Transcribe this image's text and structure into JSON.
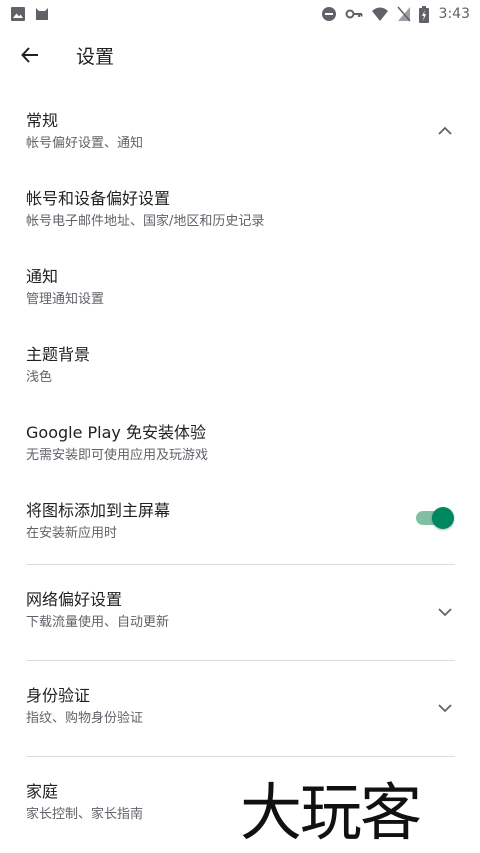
{
  "status_bar": {
    "time": "3:43",
    "icons": [
      "image-icon",
      "cat-icon",
      "do-not-disturb-icon",
      "key-icon",
      "wifi-icon",
      "no-sim-icon",
      "battery-charging-icon"
    ]
  },
  "app_bar": {
    "title": "设置",
    "back_icon": "arrow-back-icon"
  },
  "settings": [
    {
      "title": "常规",
      "subtitle": "帐号偏好设置、通知",
      "icon": "chevron-up-icon"
    },
    {
      "title": "帐号和设备偏好设置",
      "subtitle": "帐号电子邮件地址、国家/地区和历史记录"
    },
    {
      "title": "通知",
      "subtitle": "管理通知设置"
    },
    {
      "title": "主题背景",
      "subtitle": "浅色"
    },
    {
      "title": "Google Play 免安装体验",
      "subtitle": "无需安装即可使用应用及玩游戏"
    },
    {
      "title": "将图标添加到主屏幕",
      "subtitle": "在安装新应用时",
      "toggle": true
    }
  ],
  "sections": [
    {
      "title": "网络偏好设置",
      "subtitle": "下载流量使用、自动更新",
      "icon": "chevron-down-icon"
    },
    {
      "title": "身份验证",
      "subtitle": "指纹、购物身份验证",
      "icon": "chevron-down-icon"
    },
    {
      "title": "家庭",
      "subtitle": "家长控制、家长指南"
    }
  ],
  "watermark": "大玩客",
  "colors": {
    "accent": "#01875f",
    "accent_track": "#7fbfa4",
    "divider": "#dadce0"
  }
}
